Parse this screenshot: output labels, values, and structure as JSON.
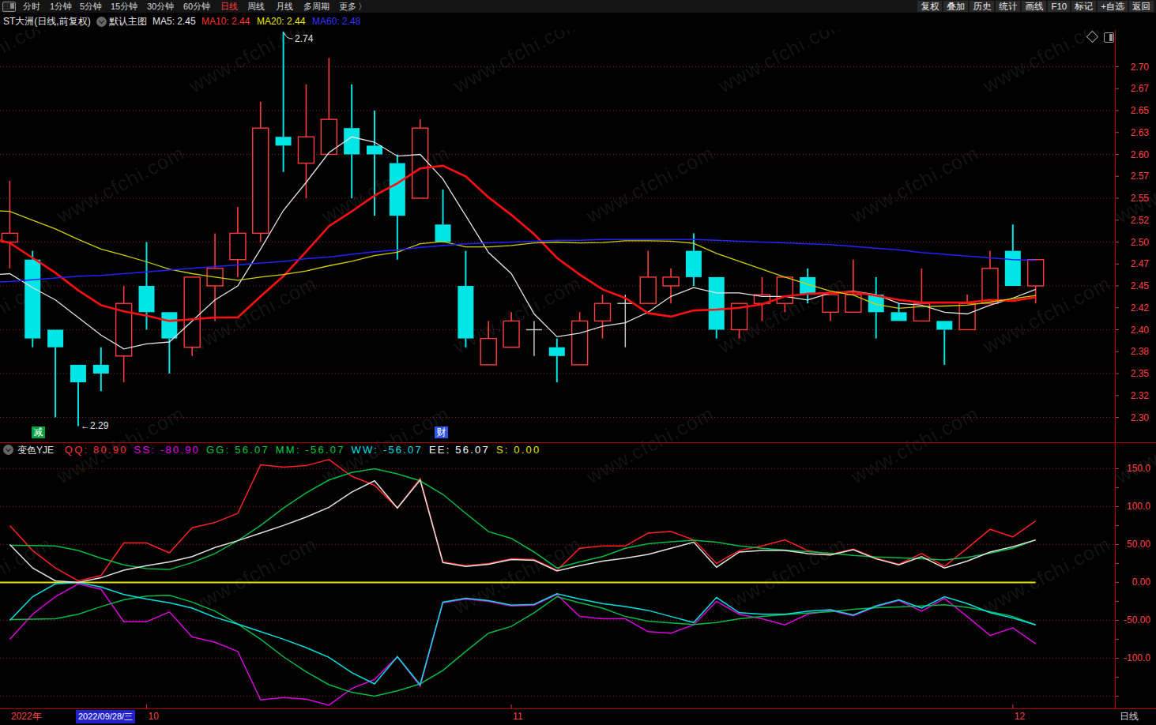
{
  "app": {
    "name": "stock-chart-app"
  },
  "menu": {
    "logo_icon": "window-icon",
    "items": [
      {
        "label": "分时"
      },
      {
        "label": "1分钟"
      },
      {
        "label": "5分钟"
      },
      {
        "label": "15分钟"
      },
      {
        "label": "30分钟"
      },
      {
        "label": "60分钟"
      },
      {
        "label": "日线",
        "active": true
      },
      {
        "label": "周线"
      },
      {
        "label": "月线"
      },
      {
        "label": "多周期"
      },
      {
        "label": "更多"
      },
      {
        "label": "〉"
      }
    ],
    "right_buttons": [
      {
        "label": "复权"
      },
      {
        "label": "叠加"
      },
      {
        "label": "历史"
      },
      {
        "label": "统计"
      },
      {
        "label": "画线"
      },
      {
        "label": "F10"
      },
      {
        "label": "标记"
      },
      {
        "label": "+自选"
      },
      {
        "label": "返回"
      }
    ],
    "active_color": "#ff3b3b"
  },
  "title_bar": {
    "stock_title": "ST大洲(日线,前复权)",
    "dropdown_icon": "chevron-down-circle-icon",
    "overlay_label": "默认主图",
    "ma_legend": [
      {
        "label": "MA5: 2.45",
        "color": "#e8e8e8"
      },
      {
        "label": "MA10: 2.44",
        "color": "#ff3232"
      },
      {
        "label": "MA20: 2.44",
        "color": "#e8e800"
      },
      {
        "label": "MA60: 2.48",
        "color": "#3333ff"
      }
    ],
    "corner_icons": [
      "diamond-icon",
      "split-panel-icon"
    ]
  },
  "chart_data": {
    "type": "candlestick",
    "title": "ST大洲(日线,前复权)",
    "period": "日线",
    "watermark": "www.cfchi.com",
    "colors": {
      "up": "#ff3b3b",
      "down": "#00e6e6",
      "flat": "#d0d0d0",
      "grid": "#8a1d1d",
      "frame": "#b40000",
      "axis_label": "#ff4343",
      "ma5": "#e4e4e4",
      "ma10": "#ff1010",
      "ma20": "#d0d000",
      "ma60": "#2222ff"
    },
    "price_axis": {
      "labels": [
        "2.70",
        "2.67",
        "2.65",
        "2.63",
        "2.60",
        "2.57",
        "2.55",
        "2.52",
        "2.50",
        "2.47",
        "2.45",
        "2.42",
        "2.40",
        "2.38",
        "2.35",
        "2.32",
        "2.30"
      ],
      "values": [
        2.7,
        2.675,
        2.65,
        2.625,
        2.6,
        2.575,
        2.55,
        2.525,
        2.5,
        2.475,
        2.45,
        2.425,
        2.4,
        2.375,
        2.35,
        2.325,
        2.3
      ],
      "grid_values": [
        2.7,
        2.65,
        2.6,
        2.55,
        2.5,
        2.45,
        2.4,
        2.35,
        2.3
      ]
    },
    "candles": [
      {
        "date": "2022/09/23",
        "o": 2.5,
        "h": 2.57,
        "l": 2.47,
        "c": 2.51
      },
      {
        "date": "2022/09/26",
        "o": 2.48,
        "h": 2.49,
        "l": 2.38,
        "c": 2.39
      },
      {
        "date": "2022/09/27",
        "o": 2.4,
        "h": 2.4,
        "l": 2.3,
        "c": 2.38
      },
      {
        "date": "2022/09/28",
        "o": 2.36,
        "h": 2.36,
        "l": 2.29,
        "c": 2.34
      },
      {
        "date": "2022/09/29",
        "o": 2.36,
        "h": 2.38,
        "l": 2.33,
        "c": 2.35
      },
      {
        "date": "2022/09/30",
        "o": 2.37,
        "h": 2.45,
        "l": 2.34,
        "c": 2.43
      },
      {
        "date": "2022/10/10",
        "o": 2.45,
        "h": 2.5,
        "l": 2.4,
        "c": 2.42
      },
      {
        "date": "2022/10/11",
        "o": 2.42,
        "h": 2.42,
        "l": 2.35,
        "c": 2.39
      },
      {
        "date": "2022/10/12",
        "o": 2.38,
        "h": 2.46,
        "l": 2.37,
        "c": 2.46
      },
      {
        "date": "2022/10/13",
        "o": 2.45,
        "h": 2.51,
        "l": 2.41,
        "c": 2.47
      },
      {
        "date": "2022/10/14",
        "o": 2.48,
        "h": 2.54,
        "l": 2.46,
        "c": 2.51
      },
      {
        "date": "2022/10/17",
        "o": 2.51,
        "h": 2.66,
        "l": 2.5,
        "c": 2.63
      },
      {
        "date": "2022/10/18",
        "o": 2.62,
        "h": 2.74,
        "l": 2.58,
        "c": 2.61
      },
      {
        "date": "2022/10/19",
        "o": 2.59,
        "h": 2.68,
        "l": 2.55,
        "c": 2.62
      },
      {
        "date": "2022/10/20",
        "o": 2.6,
        "h": 2.71,
        "l": 2.6,
        "c": 2.64
      },
      {
        "date": "2022/10/21",
        "o": 2.63,
        "h": 2.68,
        "l": 2.55,
        "c": 2.6
      },
      {
        "date": "2022/10/24",
        "o": 2.61,
        "h": 2.65,
        "l": 2.53,
        "c": 2.6
      },
      {
        "date": "2022/10/25",
        "o": 2.59,
        "h": 2.6,
        "l": 2.48,
        "c": 2.53
      },
      {
        "date": "2022/10/26",
        "o": 2.55,
        "h": 2.64,
        "l": 2.55,
        "c": 2.63
      },
      {
        "date": "2022/10/27",
        "o": 2.52,
        "h": 2.56,
        "l": 2.5,
        "c": 2.5
      },
      {
        "date": "2022/10/28",
        "o": 2.45,
        "h": 2.49,
        "l": 2.38,
        "c": 2.39
      },
      {
        "date": "2022/10/31",
        "o": 2.36,
        "h": 2.41,
        "l": 2.36,
        "c": 2.39
      },
      {
        "date": "2022/11/01",
        "o": 2.38,
        "h": 2.42,
        "l": 2.38,
        "c": 2.41
      },
      {
        "date": "2022/11/02",
        "o": 2.4,
        "h": 2.41,
        "l": 2.37,
        "c": 2.4
      },
      {
        "date": "2022/11/03",
        "o": 2.38,
        "h": 2.39,
        "l": 2.34,
        "c": 2.37
      },
      {
        "date": "2022/11/04",
        "o": 2.36,
        "h": 2.42,
        "l": 2.36,
        "c": 2.41
      },
      {
        "date": "2022/11/07",
        "o": 2.41,
        "h": 2.44,
        "l": 2.39,
        "c": 2.43
      },
      {
        "date": "2022/11/08",
        "o": 2.43,
        "h": 2.44,
        "l": 2.38,
        "c": 2.43
      },
      {
        "date": "2022/11/09",
        "o": 2.43,
        "h": 2.49,
        "l": 2.43,
        "c": 2.46
      },
      {
        "date": "2022/11/10",
        "o": 2.45,
        "h": 2.47,
        "l": 2.43,
        "c": 2.46
      },
      {
        "date": "2022/11/11",
        "o": 2.49,
        "h": 2.51,
        "l": 2.45,
        "c": 2.46
      },
      {
        "date": "2022/11/14",
        "o": 2.46,
        "h": 2.46,
        "l": 2.39,
        "c": 2.4
      },
      {
        "date": "2022/11/15",
        "o": 2.4,
        "h": 2.43,
        "l": 2.39,
        "c": 2.43
      },
      {
        "date": "2022/11/16",
        "o": 2.43,
        "h": 2.46,
        "l": 2.41,
        "c": 2.44
      },
      {
        "date": "2022/11/17",
        "o": 2.43,
        "h": 2.46,
        "l": 2.42,
        "c": 2.46
      },
      {
        "date": "2022/11/18",
        "o": 2.46,
        "h": 2.47,
        "l": 2.43,
        "c": 2.44
      },
      {
        "date": "2022/11/21",
        "o": 2.42,
        "h": 2.44,
        "l": 2.41,
        "c": 2.44
      },
      {
        "date": "2022/11/22",
        "o": 2.42,
        "h": 2.48,
        "l": 2.42,
        "c": 2.44
      },
      {
        "date": "2022/11/23",
        "o": 2.44,
        "h": 2.46,
        "l": 2.39,
        "c": 2.42
      },
      {
        "date": "2022/11/24",
        "o": 2.42,
        "h": 2.43,
        "l": 2.41,
        "c": 2.41
      },
      {
        "date": "2022/11/25",
        "o": 2.41,
        "h": 2.47,
        "l": 2.41,
        "c": 2.43
      },
      {
        "date": "2022/11/28",
        "o": 2.41,
        "h": 2.41,
        "l": 2.36,
        "c": 2.4
      },
      {
        "date": "2022/11/29",
        "o": 2.4,
        "h": 2.44,
        "l": 2.4,
        "c": 2.43
      },
      {
        "date": "2022/11/30",
        "o": 2.43,
        "h": 2.49,
        "l": 2.43,
        "c": 2.47
      },
      {
        "date": "2022/12/01",
        "o": 2.49,
        "h": 2.52,
        "l": 2.45,
        "c": 2.45
      },
      {
        "date": "2022/12/02",
        "o": 2.45,
        "h": 2.48,
        "l": 2.43,
        "c": 2.48
      }
    ],
    "ma_lines": [
      {
        "name": "MA5",
        "display": "2.45",
        "color": "#e4e4e4",
        "width": 1.3,
        "values": [
          2.462,
          2.464,
          2.448,
          2.434,
          2.414,
          2.394,
          2.378,
          2.384,
          2.386,
          2.41,
          2.434,
          2.45,
          2.492,
          2.536,
          2.568,
          2.602,
          2.62,
          2.614,
          2.598,
          2.6,
          2.572,
          2.53,
          2.488,
          2.464,
          2.418,
          2.392,
          2.396,
          2.404,
          2.408,
          2.42,
          2.438,
          2.448,
          2.442,
          2.442,
          2.438,
          2.438,
          2.434,
          2.442,
          2.444,
          2.44,
          2.43,
          2.428,
          2.42,
          2.418,
          2.428,
          2.436,
          2.446
        ]
      },
      {
        "name": "MA10",
        "display": "2.44",
        "color": "#ff1010",
        "width": 2.6,
        "values": [
          2.506,
          2.499,
          2.482,
          2.465,
          2.445,
          2.428,
          2.421,
          2.416,
          2.41,
          2.412,
          2.414,
          2.414,
          2.438,
          2.461,
          2.489,
          2.518,
          2.535,
          2.553,
          2.567,
          2.584,
          2.587,
          2.575,
          2.551,
          2.531,
          2.509,
          2.482,
          2.463,
          2.446,
          2.436,
          2.419,
          2.415,
          2.422,
          2.423,
          2.425,
          2.429,
          2.438,
          2.441,
          2.442,
          2.443,
          2.439,
          2.434,
          2.431,
          2.431,
          2.431,
          2.434,
          2.433,
          2.437
        ]
      },
      {
        "name": "MA20",
        "display": "2.44",
        "color": "#d0d000",
        "width": 1.3,
        "values": [
          2.5363,
          2.535,
          2.525,
          2.515,
          2.503,
          2.492,
          2.485,
          2.4775,
          2.469,
          2.464,
          2.46,
          2.4565,
          2.46,
          2.463,
          2.467,
          2.473,
          2.478,
          2.4845,
          2.4885,
          2.498,
          2.5005,
          2.4945,
          2.4945,
          2.496,
          2.499,
          2.5,
          2.499,
          2.4995,
          2.5015,
          2.5015,
          2.501,
          2.4985,
          2.487,
          2.478,
          2.469,
          2.46,
          2.452,
          2.444,
          2.4395,
          2.429,
          2.4245,
          2.4265,
          2.427,
          2.428,
          2.4315,
          2.4355,
          2.439
        ]
      },
      {
        "name": "MA60",
        "display": "2.48",
        "color": "#2222ff",
        "width": 1.5,
        "values": [
          2.454,
          2.455,
          2.457,
          2.459,
          2.461,
          2.462,
          2.464,
          2.466,
          2.468,
          2.47,
          2.472,
          2.474,
          2.476,
          2.478,
          2.481,
          2.483,
          2.486,
          2.489,
          2.491,
          2.494,
          2.496,
          2.498,
          2.499,
          2.5,
          2.501,
          2.502,
          2.502,
          2.503,
          2.503,
          2.503,
          2.503,
          2.503,
          2.502,
          2.501,
          2.5,
          2.499,
          2.498,
          2.497,
          2.495,
          2.493,
          2.491,
          2.488,
          2.486,
          2.484,
          2.482,
          2.48,
          2.479
        ]
      }
    ],
    "annotations": [
      {
        "text": "2.74",
        "type": "highest"
      },
      {
        "text": "←2.29",
        "type": "lowest"
      }
    ],
    "event_badges": [
      {
        "label": "减",
        "bg": "#00a040",
        "x": 40
      },
      {
        "label": "财",
        "bg": "#2f56e0",
        "x": 550
      }
    ],
    "indicator": {
      "name": "变色YJE",
      "params": [
        {
          "label": "QQ: 80.90",
          "color": "#ff3232"
        },
        {
          "label": "SS: -80.90",
          "color": "#e800e8"
        },
        {
          "label": "GG: 56.07",
          "color": "#00cc44"
        },
        {
          "label": "MM: -56.07",
          "color": "#00cc44"
        },
        {
          "label": "WW: -56.07",
          "color": "#00e0e0"
        },
        {
          "label": "EE: 56.07",
          "color": "#ffffff"
        },
        {
          "label": "S: 0.00",
          "color": "#e8e800"
        }
      ],
      "y_axis": {
        "labels": [
          "150.0",
          "100.0",
          "50.00",
          "0.00",
          "-50.00",
          "-100.0"
        ],
        "values": [
          150,
          100,
          50,
          0,
          -50,
          -100
        ],
        "grid_values": [
          150,
          100,
          50,
          -50,
          -100,
          -150
        ]
      },
      "series": [
        {
          "name": "QQ",
          "color": "#ff2020",
          "width": 1.5,
          "values": [
            75,
            42,
            19,
            2,
            9,
            52,
            52,
            39,
            72,
            79,
            91,
            155,
            152,
            154,
            162,
            140,
            128,
            98,
            137,
            27,
            22,
            25,
            31,
            30,
            16,
            45,
            48,
            48,
            65,
            67,
            56,
            25,
            42,
            48,
            56,
            42,
            37,
            44,
            32,
            24,
            38,
            21,
            45,
            70,
            60,
            80.9
          ]
        },
        {
          "name": "SS",
          "color": "#dd00dd",
          "width": 1.5,
          "values": [
            -75,
            -42,
            -19,
            -2,
            -9,
            -52,
            -52,
            -39,
            -72,
            -79,
            -91,
            -155,
            -152,
            -154,
            -162,
            -140,
            -128,
            -98,
            -137,
            -27,
            -22,
            -25,
            -31,
            -30,
            -16,
            -45,
            -48,
            -48,
            -65,
            -67,
            -56,
            -25,
            -42,
            -48,
            -56,
            -42,
            -37,
            -44,
            -32,
            -24,
            -38,
            -21,
            -45,
            -70,
            -60,
            -80.9
          ]
        },
        {
          "name": "GG",
          "color": "#00bb44",
          "width": 1.5,
          "values": [
            49,
            48.5,
            48,
            42,
            32,
            23,
            18,
            17,
            26,
            38,
            55,
            75,
            98,
            118,
            135,
            145,
            150,
            143,
            134,
            116,
            91,
            67,
            58,
            40,
            19,
            27,
            34,
            45,
            51,
            53.5,
            55.5,
            53,
            48,
            45,
            42.5,
            40.5,
            38.5,
            35.5,
            33.5,
            32.5,
            31,
            29.5,
            33,
            38.5,
            45,
            56.07
          ]
        },
        {
          "name": "MM",
          "color": "#00bb44",
          "width": 1.5,
          "values": [
            -49,
            -48.5,
            -48,
            -42,
            -32,
            -23,
            -18,
            -17,
            -26,
            -38,
            -55,
            -75,
            -98,
            -118,
            -135,
            -145,
            -150,
            -143,
            -134,
            -116,
            -91,
            -67,
            -58,
            -40,
            -19,
            -27,
            -34,
            -45,
            -51,
            -53.5,
            -55.5,
            -53,
            -48,
            -45,
            -42.5,
            -40.5,
            -38.5,
            -35.5,
            -33.5,
            -32.5,
            -31,
            -29.5,
            -33,
            -38.5,
            -45,
            -56.07
          ]
        },
        {
          "name": "WW",
          "color": "#00e0e0",
          "width": 1.5,
          "values": [
            -50,
            -19,
            -2,
            0,
            -6,
            -16,
            -22,
            -27,
            -34,
            -46,
            -55,
            -65,
            -75,
            -86,
            -99,
            -119,
            -134,
            -98,
            -135,
            -26,
            -21,
            -24,
            -30,
            -29,
            -15,
            -22,
            -28,
            -32,
            -37,
            -45,
            -53,
            -20,
            -40,
            -42,
            -42,
            -38,
            -36,
            -43,
            -31,
            -23,
            -34,
            -19,
            -28,
            -40,
            -47,
            -56.07
          ]
        },
        {
          "name": "EE",
          "color": "#e2e2e2",
          "width": 1.5,
          "values": [
            50,
            19,
            2,
            0,
            6,
            16,
            22,
            27,
            34,
            46,
            55,
            65,
            75,
            86,
            99,
            119,
            134,
            98,
            135,
            26,
            21,
            24,
            30,
            29,
            15,
            22,
            28,
            32,
            37,
            45,
            53,
            20,
            40,
            42,
            42,
            38,
            36,
            43,
            31,
            23,
            34,
            19,
            28,
            40,
            47,
            56.07
          ]
        },
        {
          "name": "S",
          "color": "#e6e600",
          "width": 2,
          "value": 0
        }
      ]
    }
  },
  "status_bar": {
    "year": "2022年",
    "selected_date": "2022/09/28/三",
    "selected_date_bg": "#2222cc",
    "months": [
      {
        "label": "10",
        "candle_index": 6
      },
      {
        "label": "11",
        "candle_index": 22
      },
      {
        "label": "12",
        "candle_index": 44
      }
    ],
    "period": "日线"
  }
}
